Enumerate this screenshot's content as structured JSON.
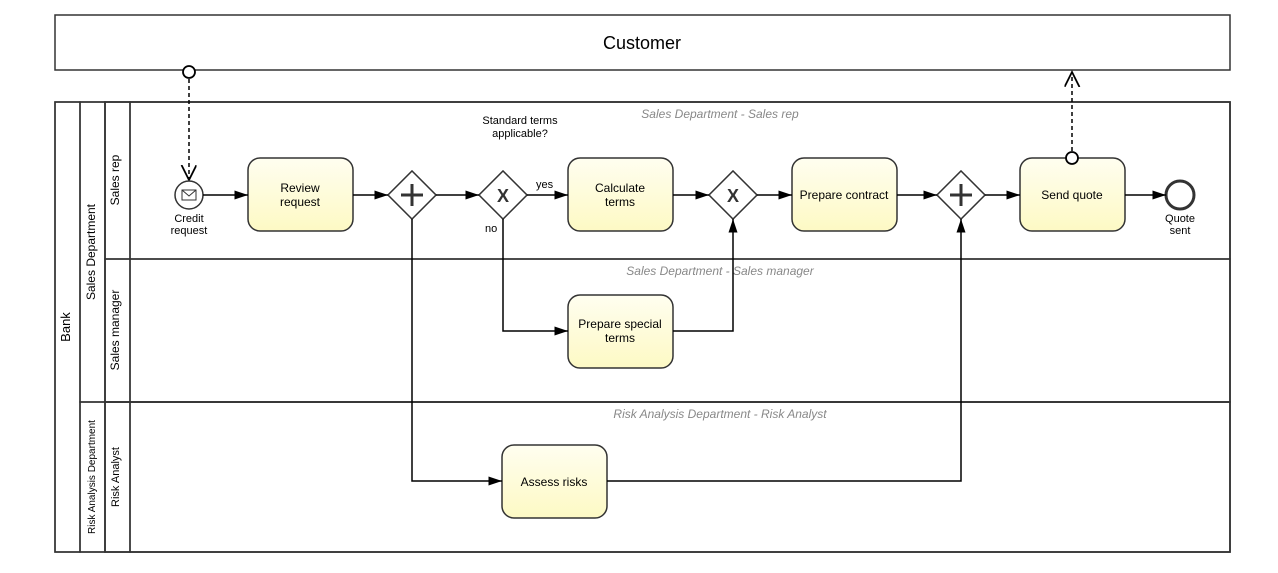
{
  "pools": {
    "customer": {
      "title": "Customer"
    },
    "bank": {
      "title": "Bank",
      "lanes": {
        "sales_dept": {
          "title": "Sales Department",
          "sublanes": {
            "sales_rep": {
              "title": "Sales rep",
              "note": "Sales Department - Sales rep"
            },
            "sales_mgr": {
              "title": "Sales manager",
              "note": "Sales Department - Sales manager"
            }
          }
        },
        "risk_dept": {
          "title": "Risk Analysis Department",
          "sublanes": {
            "risk_analyst": {
              "title": "Risk Analyst",
              "note": "Risk Analysis Department - Risk Analyst"
            }
          }
        }
      }
    }
  },
  "events": {
    "start": {
      "label": "Credit request"
    },
    "end": {
      "label": "Quote sent"
    }
  },
  "tasks": {
    "review": {
      "label": "Review request"
    },
    "calc_terms": {
      "label": "Calculate terms"
    },
    "prep_contract": {
      "label": "Prepare contract"
    },
    "send_quote": {
      "label": "Send quote"
    },
    "prep_special": {
      "label": "Prepare special terms"
    },
    "assess_risks": {
      "label": "Assess risks"
    }
  },
  "gateways": {
    "parallel1": {
      "type": "parallel"
    },
    "exclusive1": {
      "type": "exclusive",
      "question_l1": "Standard terms",
      "question_l2": "applicable?",
      "yes": "yes",
      "no": "no"
    },
    "exclusive2": {
      "type": "exclusive"
    },
    "parallel2": {
      "type": "parallel"
    }
  }
}
